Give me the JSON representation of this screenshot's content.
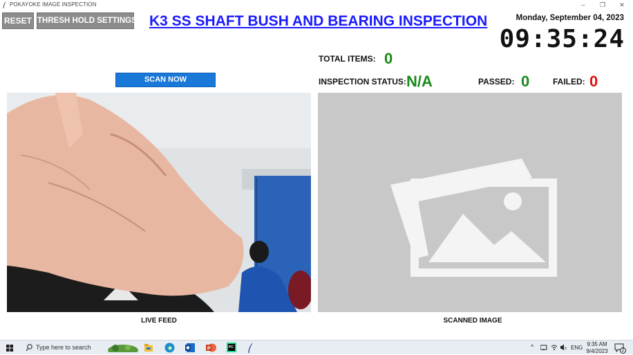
{
  "window": {
    "title": "POKAYOKE IMAGE INSPECTION",
    "minimize_glyph": "–",
    "restore_glyph": "❐",
    "close_glyph": "✕"
  },
  "toolbar": {
    "reset_label": "RESET",
    "thresh_label": "THRESH HOLD SETTINGS"
  },
  "header": {
    "title": "K3 SS SHAFT BUSH AND BEARING INSPECTION",
    "date": "Monday, September 04, 2023",
    "time": "09:35:24"
  },
  "stats": {
    "total_items_label": "TOTAL ITEMS:",
    "total_items_value": "0",
    "inspection_status_label": "INSPECTION STATUS:",
    "inspection_status_value": "N/A",
    "passed_label": "PASSED:",
    "passed_value": "0",
    "failed_label": "FAILED:",
    "failed_value": "0"
  },
  "colors": {
    "accent_blue": "#1a78d8",
    "title_blue": "#1a1aff",
    "pass_green": "#1a8a1a",
    "fail_red": "#e01010",
    "button_gray": "#8c8c8c"
  },
  "scan": {
    "label": "SCAN NOW"
  },
  "panels": {
    "live_caption": "LIVE FEED",
    "scanned_caption": "SCANNED IMAGE"
  },
  "taskbar": {
    "search_placeholder": "Type here to search",
    "language": "ENG",
    "time": "9:35 AM",
    "date": "9/4/2023",
    "notification_count": "2",
    "icons": [
      "windows-start-icon",
      "search-icon",
      "widgets-icon",
      "file-explorer-icon",
      "edge-icon",
      "outlook-icon",
      "powerpoint-icon",
      "pycharm-icon",
      "feather-app-icon",
      "chevron-up-icon",
      "network-icon",
      "wifi-icon",
      "volume-icon",
      "notification-icon"
    ]
  }
}
